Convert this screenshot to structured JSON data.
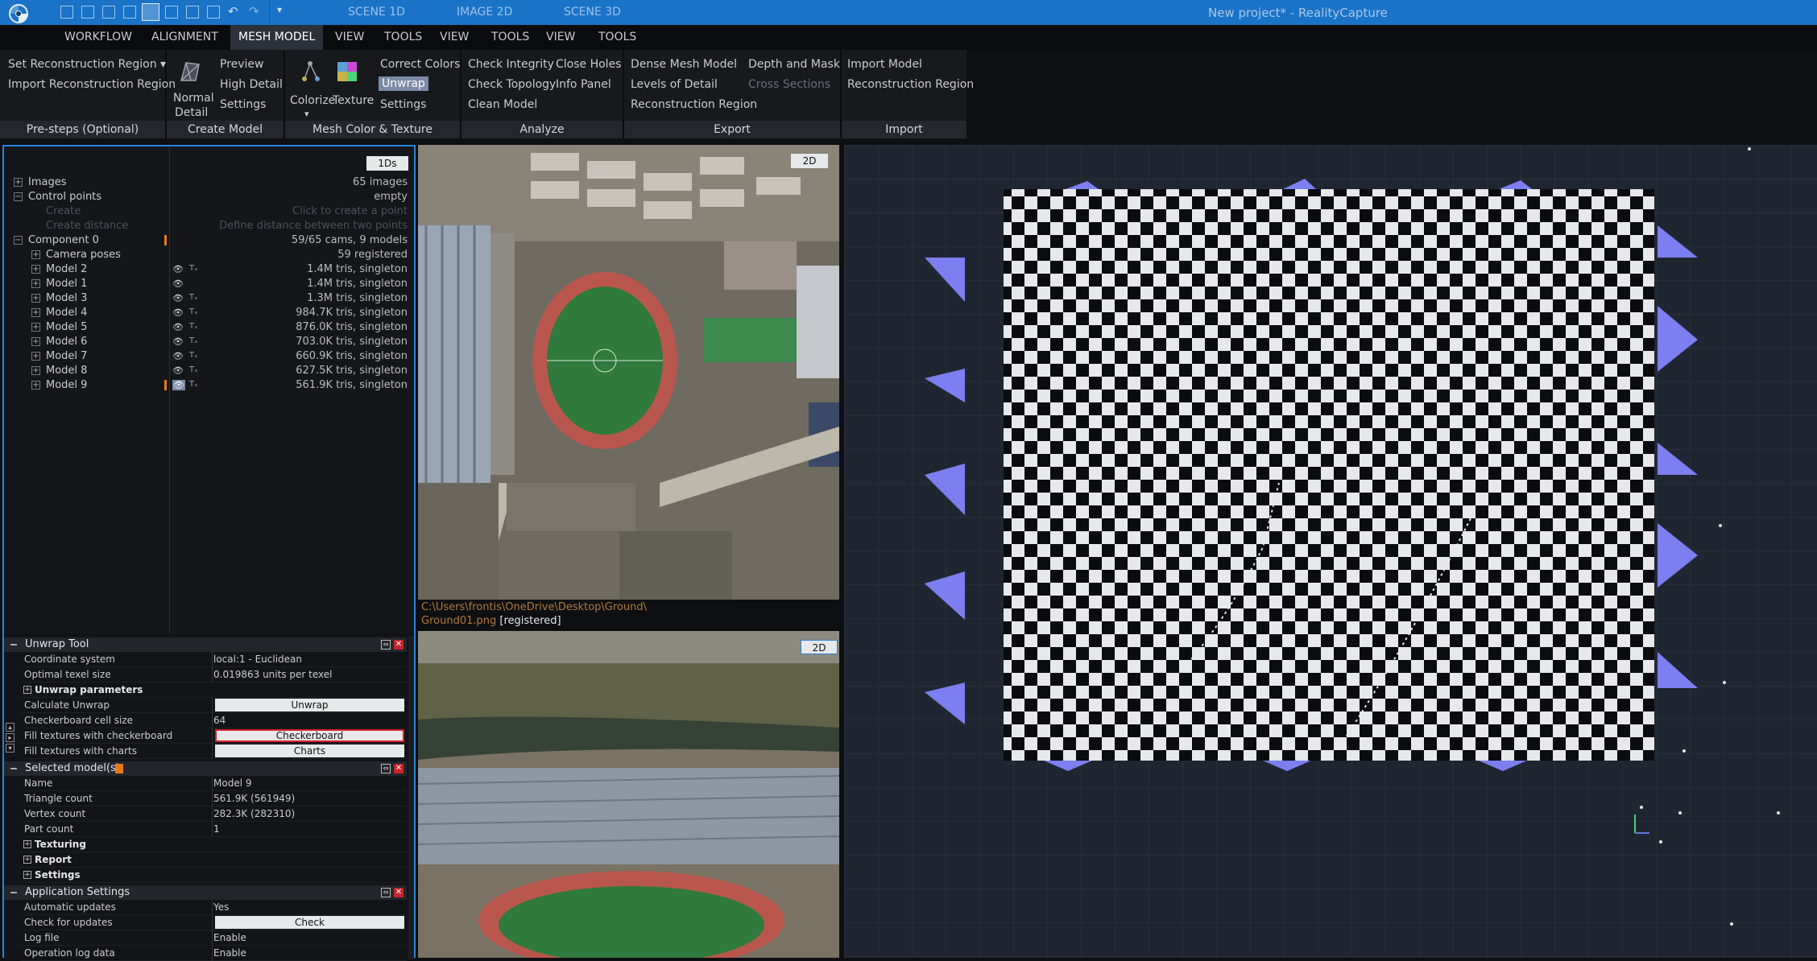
{
  "titlebar": {
    "scenes": [
      "SCENE 1D",
      "IMAGE 2D",
      "SCENE 3D"
    ],
    "title": "New project* - RealityCapture"
  },
  "menu": {
    "tabs": [
      "WORKFLOW",
      "ALIGNMENT",
      "MESH MODEL",
      "TOOLS",
      "VIEW",
      "TOOLS",
      "VIEW",
      "TOOLS"
    ],
    "active": "MESH MODEL"
  },
  "ribbon": {
    "presteps": {
      "title": "Pre-steps (Optional)",
      "set_region": "Set Reconstruction Region",
      "import_region": "Import Reconstruction Region"
    },
    "create": {
      "title": "Create Model",
      "normal": "Normal",
      "detail": "Detail",
      "preview": "Preview",
      "high_detail": "High Detail",
      "settings": "Settings"
    },
    "color": {
      "title": "Mesh Color & Texture",
      "colorize": "Colorize",
      "texture": "Texture",
      "correct_colors": "Correct Colors",
      "unwrap": "Unwrap",
      "settings": "Settings"
    },
    "analyze": {
      "title": "Analyze",
      "check_integrity": "Check Integrity",
      "check_topology": "Check Topology",
      "clean_model": "Clean Model",
      "close_holes": "Close Holes",
      "info_panel": "Info Panel"
    },
    "export": {
      "title": "Export",
      "dense_mesh": "Dense Mesh Model",
      "levels": "Levels of Detail",
      "recon_region": "Reconstruction Region",
      "depth_mask": "Depth and Mask",
      "cross_sections": "Cross Sections"
    },
    "import": {
      "title": "Import",
      "import_model": "Import Model",
      "recon_region": "Reconstruction Region"
    }
  },
  "tree": {
    "badge": "1Ds",
    "images": {
      "label": "Images",
      "value": "65 images"
    },
    "control_points": {
      "label": "Control points",
      "value": "empty"
    },
    "create": {
      "label": "Create",
      "value": "Click to create a point"
    },
    "create_distance": {
      "label": "Create distance",
      "value": "Define distance between two points"
    },
    "component": {
      "label": "Component 0",
      "value": "59/65 cams, 9 models"
    },
    "camera_poses": {
      "label": "Camera poses",
      "value": "59 registered"
    },
    "models": [
      {
        "label": "Model 2",
        "value": "1.4M tris, singleton"
      },
      {
        "label": "Model 1",
        "value": "1.4M tris, singleton"
      },
      {
        "label": "Model 3",
        "value": "1.3M tris, singleton"
      },
      {
        "label": "Model 4",
        "value": "984.7K tris, singleton"
      },
      {
        "label": "Model 5",
        "value": "876.0K tris, singleton"
      },
      {
        "label": "Model 6",
        "value": "703.0K tris, singleton"
      },
      {
        "label": "Model 7",
        "value": "660.9K tris, singleton"
      },
      {
        "label": "Model 8",
        "value": "627.5K tris, singleton"
      },
      {
        "label": "Model 9",
        "value": "561.9K tris, singleton"
      }
    ]
  },
  "unwrap": {
    "title": "Unwrap Tool",
    "rows": [
      {
        "k": "Coordinate system",
        "v": "local:1 - Euclidean"
      },
      {
        "k": "Optimal texel size",
        "v": "0.019863 units per texel"
      }
    ],
    "params": "Unwrap parameters",
    "calc": {
      "k": "Calculate Unwrap",
      "btn": "Unwrap"
    },
    "cell": {
      "k": "Checkerboard cell size",
      "v": "64"
    },
    "fill_check": {
      "k": "Fill textures with checkerboard",
      "btn": "Checkerboard"
    },
    "fill_charts": {
      "k": "Fill textures with charts",
      "btn": "Charts"
    }
  },
  "selected": {
    "title": "Selected model(s)",
    "rows": [
      {
        "k": "Name",
        "v": "Model 9"
      },
      {
        "k": "Triangle count",
        "v": "561.9K (561949)"
      },
      {
        "k": "Vertex count",
        "v": "282.3K (282310)"
      },
      {
        "k": "Part count",
        "v": "1"
      }
    ],
    "sections": [
      "Texturing",
      "Report",
      "Settings"
    ]
  },
  "appsettings": {
    "title": "Application Settings",
    "auto": {
      "k": "Automatic updates",
      "v": "Yes"
    },
    "check": {
      "k": "Check for updates",
      "btn": "Check"
    },
    "log": {
      "k": "Log file",
      "v": "Enable"
    },
    "oplog": {
      "k": "Operation log data",
      "v": "Enable"
    }
  },
  "image2d": {
    "badge": "2D",
    "path": "C:\\Users\\frontis\\OneDrive\\Desktop\\Ground\\",
    "file": "Ground01.png",
    "status": "[registered]"
  },
  "image2d_b": {
    "badge": "2D"
  },
  "colors": {
    "accent": "#1a73c7",
    "selected_border": "#2b84d8",
    "camera": "#7b7ff0",
    "highlight": "#d6212b"
  }
}
